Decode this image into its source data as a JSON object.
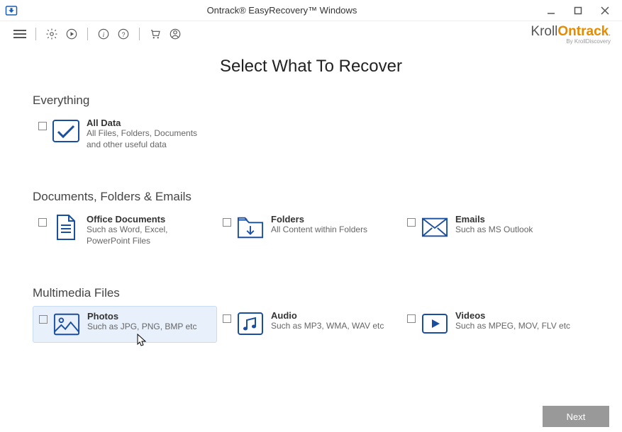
{
  "window": {
    "title": "Ontrack® EasyRecovery™ Windows"
  },
  "brand": {
    "main": "Kroll",
    "accent": "Ontrack",
    "sub": "By KrollDiscovery"
  },
  "page": {
    "title": "Select What To Recover"
  },
  "sections": {
    "everything": {
      "label": "Everything",
      "allData": {
        "title": "All Data",
        "desc": "All Files, Folders, Documents and other useful data"
      }
    },
    "docs": {
      "label": "Documents, Folders & Emails",
      "office": {
        "title": "Office Documents",
        "desc": "Such as Word, Excel, PowerPoint Files"
      },
      "folders": {
        "title": "Folders",
        "desc": "All Content within Folders"
      },
      "emails": {
        "title": "Emails",
        "desc": "Such as MS Outlook"
      }
    },
    "media": {
      "label": "Multimedia Files",
      "photos": {
        "title": "Photos",
        "desc": "Such as JPG, PNG, BMP etc"
      },
      "audio": {
        "title": "Audio",
        "desc": "Such as MP3, WMA, WAV etc"
      },
      "videos": {
        "title": "Videos",
        "desc": "Such as MPEG, MOV, FLV etc"
      }
    }
  },
  "footer": {
    "next": "Next"
  }
}
